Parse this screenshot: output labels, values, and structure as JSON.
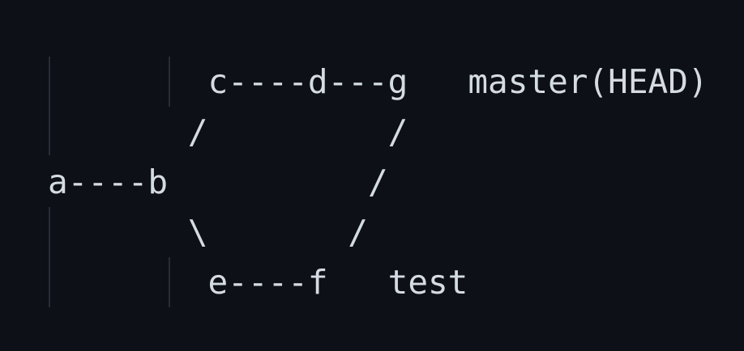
{
  "editor": {
    "lines": [
      "        c----d---g   master(HEAD)",
      "       /         /",
      "a----b          /",
      "       \\       /",
      "        e----f   test"
    ]
  }
}
